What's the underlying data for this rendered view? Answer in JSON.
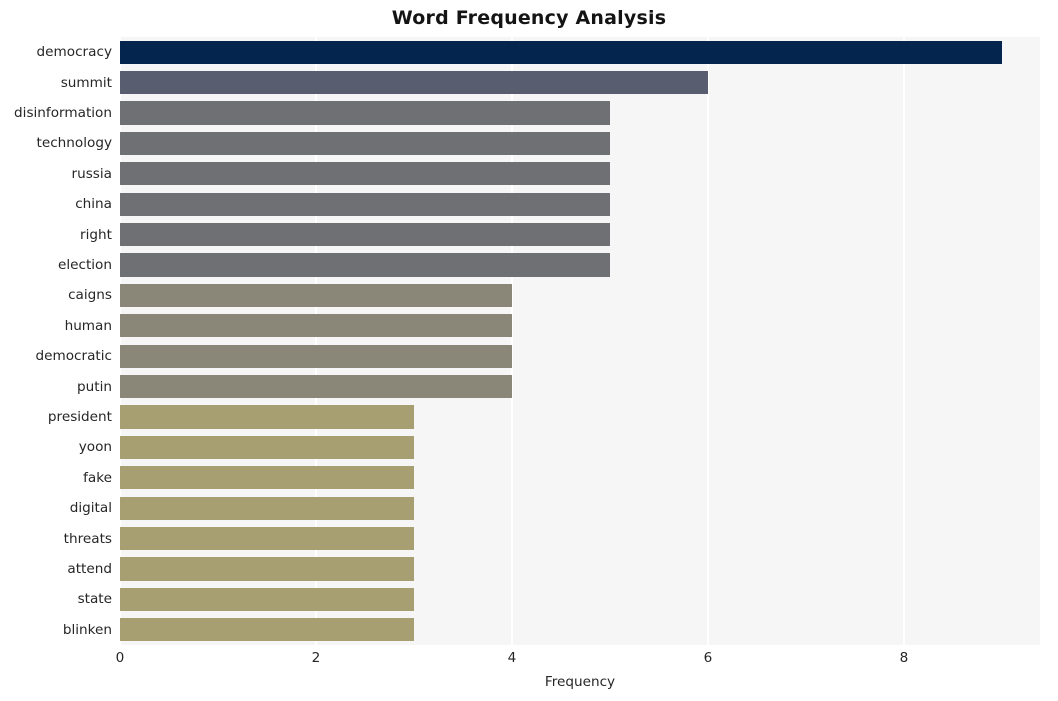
{
  "chart_data": {
    "type": "bar",
    "orientation": "horizontal",
    "title": "Word Frequency Analysis",
    "xlabel": "Frequency",
    "ylabel": "",
    "categories": [
      "democracy",
      "summit",
      "disinformation",
      "technology",
      "russia",
      "china",
      "right",
      "election",
      "caigns",
      "human",
      "democratic",
      "putin",
      "president",
      "yoon",
      "fake",
      "digital",
      "threats",
      "attend",
      "state",
      "blinken"
    ],
    "values": [
      9,
      6,
      5,
      5,
      5,
      5,
      5,
      5,
      4,
      4,
      4,
      4,
      3,
      3,
      3,
      3,
      3,
      3,
      3,
      3
    ],
    "bar_colors": [
      "#04254e",
      "#585e70",
      "#6e7073",
      "#6e7073",
      "#6e7073",
      "#6e7073",
      "#6e7073",
      "#6e7073",
      "#8a8779",
      "#8a8779",
      "#8a8779",
      "#8a8779",
      "#a79e71",
      "#a79e71",
      "#a79e71",
      "#a79e71",
      "#a79e71",
      "#a79e71",
      "#a79e71",
      "#a79e71"
    ],
    "xlim": [
      0,
      9.388
    ],
    "xticks": [
      0,
      2,
      4,
      6,
      8
    ],
    "xticklabels": [
      "0",
      "2",
      "4",
      "6",
      "8"
    ],
    "grid": "vertical-white",
    "plot_background": "#f6f6f7",
    "figure_background": "#ffffff",
    "legend": null
  }
}
